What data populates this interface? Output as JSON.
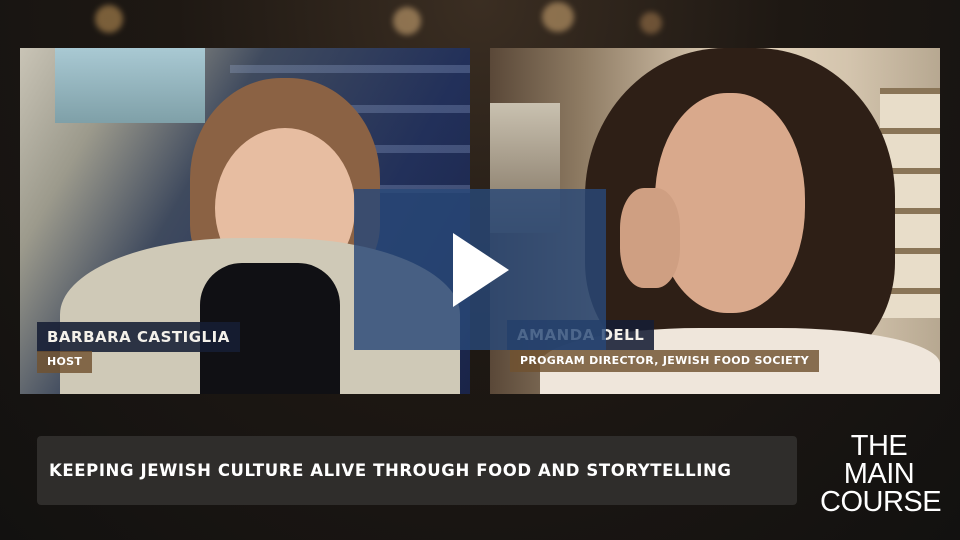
{
  "video": {
    "left_speaker": {
      "name": "BARBARA CASTIGLIA",
      "role": "HOST"
    },
    "right_speaker": {
      "name": "AMANDA DELL",
      "role": "PROGRAM DIRECTOR, JEWISH FOOD SOCIETY"
    },
    "play_icon": "play-icon",
    "caption": "KEEPING JEWISH CULTURE ALIVE THROUGH FOOD AND STORYTELLING",
    "logo": {
      "line1": "THE",
      "line2": "MAIN",
      "line3": "COURSE"
    }
  },
  "colors": {
    "name_tag_bg": "#161e34",
    "role_tag_bg": "#705230",
    "play_overlay": "#284878",
    "caption_bar": "#2f2d2b"
  }
}
